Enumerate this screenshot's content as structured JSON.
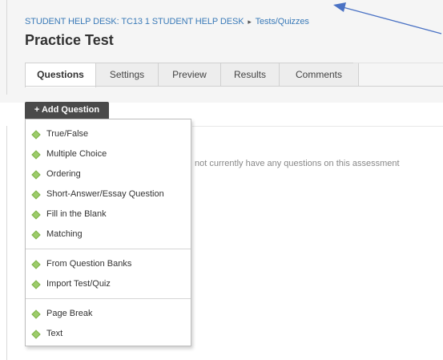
{
  "breadcrumb": {
    "course": "STUDENT HELP DESK: TC13 1 STUDENT HELP DESK",
    "separator": "▸",
    "section": "Tests/Quizzes"
  },
  "page": {
    "title": "Practice Test"
  },
  "tabs": [
    {
      "label": "Questions",
      "active": true
    },
    {
      "label": "Settings",
      "active": false
    },
    {
      "label": "Preview",
      "active": false
    },
    {
      "label": "Results",
      "active": false
    },
    {
      "label": "Comments",
      "active": false
    }
  ],
  "add_question": {
    "label": "+ Add Question"
  },
  "main": {
    "empty_message": "not currently have any questions on this assessment"
  },
  "menu": {
    "groups": [
      {
        "items": [
          {
            "label": "True/False",
            "icon": "diamond-bullet-icon"
          },
          {
            "label": "Multiple Choice",
            "icon": "diamond-bullet-icon"
          },
          {
            "label": "Ordering",
            "icon": "diamond-bullet-icon"
          },
          {
            "label": "Short-Answer/Essay Question",
            "icon": "diamond-bullet-icon"
          },
          {
            "label": "Fill in the Blank",
            "icon": "diamond-bullet-icon"
          },
          {
            "label": "Matching",
            "icon": "diamond-bullet-icon"
          }
        ]
      },
      {
        "items": [
          {
            "label": "From Question Banks",
            "icon": "diamond-bullet-icon"
          },
          {
            "label": "Import Test/Quiz",
            "icon": "diamond-bullet-icon"
          }
        ]
      },
      {
        "items": [
          {
            "label": "Page Break",
            "icon": "diamond-bullet-icon"
          },
          {
            "label": "Text",
            "icon": "diamond-bullet-icon"
          }
        ]
      }
    ]
  },
  "colors": {
    "link": "#3a7ab8",
    "button_dark": "#4a4a4a",
    "bullet_green": "#9ccc6a",
    "annotation_arrow": "#4a72c4"
  }
}
